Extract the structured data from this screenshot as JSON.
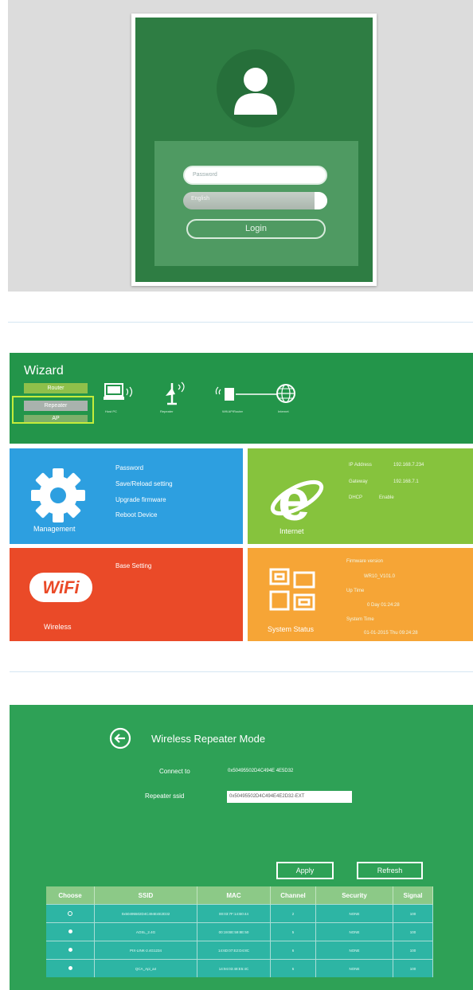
{
  "login": {
    "password_placeholder": "Password",
    "language_value": "English",
    "login_label": "Login"
  },
  "wizard": {
    "title": "Wizard",
    "modes": [
      "Router",
      "Repeater",
      "AP"
    ],
    "selected_mode": "Repeater",
    "topology": [
      "Host PC",
      "Repeater",
      "Wifi AP/Router",
      "Internet"
    ]
  },
  "tiles": {
    "management": {
      "label": "Management",
      "links": [
        "Password",
        "Save/Reload setting",
        "Upgrade firmware",
        "Reboot Device"
      ],
      "color": "#2d9fe0"
    },
    "internet": {
      "label": "Internet",
      "ip_label": "IP Address",
      "ip_value": "192.168.7.234",
      "gateway_label": "Gateway",
      "gateway_value": "192.168.7.1",
      "dhcp_label": "DHCP",
      "dhcp_value": "Enable",
      "color": "#86c33d"
    },
    "wireless": {
      "label": "Wireless",
      "links": [
        "Base Setting"
      ],
      "logo_text": "WiFi",
      "color": "#ea4a28"
    },
    "status": {
      "label": "System Status",
      "firmware_label": "Firmware version",
      "firmware_value": "WR10_V101.0",
      "uptime_label": "Up Time",
      "uptime_value": "0 Day 01:24:28",
      "systime_label": "System Time",
      "systime_value": "01-01-2015 Thu 09:24:28",
      "color": "#f6a536"
    }
  },
  "repeater": {
    "title": "Wireless Repeater Mode",
    "connect_label": "Connect to",
    "connect_value": "0x50495502D4C494E 4E5D32",
    "ssid_label": "Repeater ssid",
    "ssid_value": "0x50495502D4C494E4E2D32-EXT",
    "apply_label": "Apply",
    "refresh_label": "Refresh",
    "table": {
      "headers": [
        "Choose",
        "SSID",
        "MAC",
        "Channel",
        "Security",
        "Signal"
      ],
      "rows": [
        {
          "selected": false,
          "ssid": "0x50495502D4C494E4E2D32",
          "mac": "00:03:7F:14:B0:44",
          "channel": "2",
          "security": "NONE",
          "signal": "100"
        },
        {
          "selected": true,
          "ssid": "AOSL_2.4G",
          "mac": "00:19:BE:59:8E:50",
          "channel": "5",
          "security": "NONE",
          "signal": "100"
        },
        {
          "selected": true,
          "ssid": "PIX-LINK-2.4G1234",
          "mac": "14:6D:07:E2:D4:8C",
          "channel": "6",
          "security": "NONE",
          "signal": "100"
        },
        {
          "selected": true,
          "ssid": "QCA_Api_a4",
          "mac": "14:94:03:48:E5:4C",
          "channel": "6",
          "security": "NONE",
          "signal": "100"
        }
      ]
    }
  },
  "colors": {
    "login_green": "#2e7d43",
    "wizard_green": "#23954a",
    "repeater_green": "#2ea156",
    "table_row": "#2db5a4",
    "table_header": "#8cc987"
  }
}
